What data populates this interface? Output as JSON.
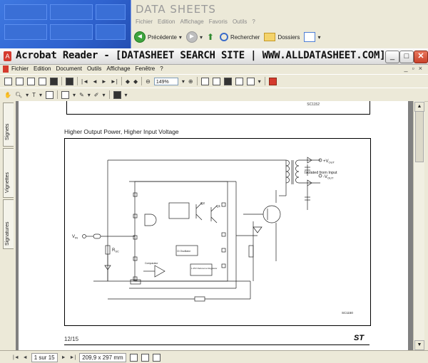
{
  "ie": {
    "title": "DATA SHEETS",
    "menu": [
      "Fichier",
      "Edition",
      "Affichage",
      "Favoris",
      "Outils",
      "?"
    ],
    "toolbar": {
      "back_label": "Précédente",
      "search_label": "Rechercher",
      "folders_label": "Dossiers"
    }
  },
  "acrobat": {
    "title": "Acrobat Reader - [DATASHEET SEARCH SITE | WWW.ALLDATASHEET.COM]",
    "menu": [
      "Fichier",
      "Edition",
      "Document",
      "Outils",
      "Affichage",
      "Fenêtre",
      "?"
    ],
    "zoom": "149%",
    "side_tabs": [
      "Signets",
      "Vignettes",
      "Signatures"
    ],
    "status": {
      "page": "1 sur 15",
      "size": "209,9 x 297 mm"
    }
  },
  "document": {
    "prev_code": "SC1152",
    "section_title": "Higher Output Power, Higher Input Voltage",
    "page_number": "12/15",
    "logo": "ST",
    "circuit": {
      "vout_pos": "+V",
      "vout_neg": "-V",
      "out_sub": "OUT",
      "isolated": "Isolated from Input",
      "vin": "V",
      "vin_sub": "IN",
      "rsc": "R",
      "rsc_sub": "SC",
      "q2": "Q2",
      "q1": "Q1",
      "oscillator": "Ct Oscillator",
      "ref": "1.25V Reference Regulator",
      "comparator": "Comparator",
      "code": "SC1150"
    }
  }
}
